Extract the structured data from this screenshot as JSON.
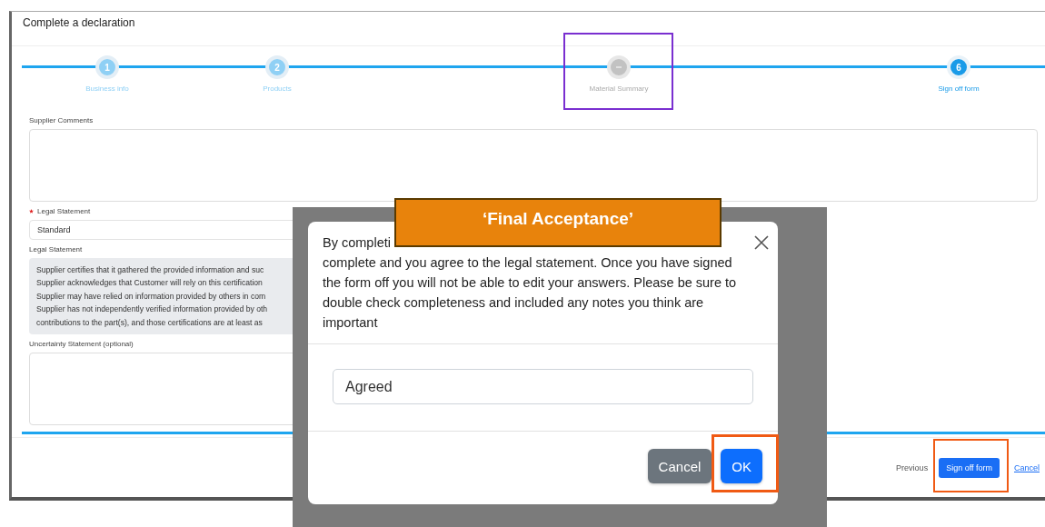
{
  "window": {
    "title": "Complete a declaration"
  },
  "steps": [
    {
      "number": "1",
      "label": "Business info",
      "done": true,
      "current": false,
      "highlighted": false
    },
    {
      "number": "2",
      "label": "Products",
      "done": true,
      "current": false,
      "highlighted": false
    },
    {
      "label": "Material Summary",
      "done": false,
      "current": false,
      "highlighted": true
    },
    {
      "number": "6",
      "label": "Sign off form",
      "done": false,
      "current": true,
      "highlighted": false
    }
  ],
  "fields": [
    {
      "kind": "textarea",
      "label": "Supplier Comments",
      "wide": true
    },
    {
      "kind": "select",
      "label": "Legal Statement",
      "required": true,
      "value": "Standard",
      "wide": false
    },
    {
      "kind": "readonly",
      "label": "Legal Statement",
      "wide": false,
      "lines": [
        "Supplier certifies that it gathered the provided information and suc",
        "Supplier acknowledges that Customer will rely on this certification",
        "Supplier may have relied on information provided by others in com",
        "Supplier has not independently verified information provided by oth",
        "contributions to the part(s), and those certifications are at least as"
      ]
    },
    {
      "kind": "textarea",
      "label": "Uncertainty Statement (optional)",
      "wide": false
    }
  ],
  "footer": {
    "previous": "Previous",
    "primary": {
      "label": "Sign off form",
      "highlighted": true
    },
    "cancel": "Cancel"
  },
  "modal": {
    "lead": "By completi",
    "body": "complete and you agree to the legal statement. Once you have signed the form off you will not be able to edit your answers. Please be sure to double check completeness and included any notes you think are important",
    "value": "Agreed",
    "buttons": [
      {
        "kind": "secondary",
        "label": "Cancel",
        "highlighted": false
      },
      {
        "kind": "primary",
        "label": "OK",
        "highlighted": true
      }
    ]
  },
  "callout": {
    "label": "‘Final Acceptance’"
  }
}
